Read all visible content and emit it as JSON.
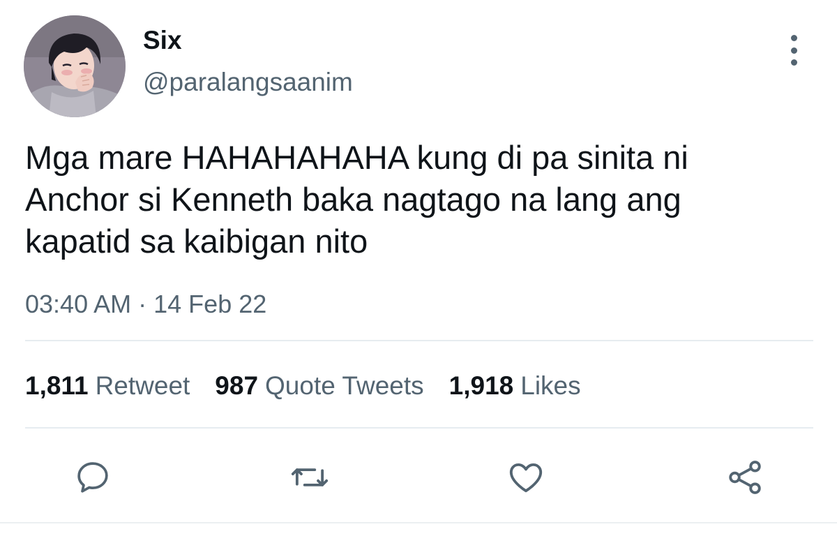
{
  "tweet": {
    "display_name": "Six",
    "handle": "@paralangsaanim",
    "text": "Mga mare HAHAHAHAHA kung di pa sinita ni\nAnchor si Kenneth baka nagtago na lang ang\nkapatid sa kaibigan nito",
    "time": "03:40 AM",
    "separator": "·",
    "date": "14 Feb 22"
  },
  "stats": {
    "retweets_count": "1,811",
    "retweets_label": "Retweet",
    "quotes_count": "987",
    "quotes_label": "Quote Tweets",
    "likes_count": "1,918",
    "likes_label": "Likes"
  },
  "icons": {
    "more": "more-vertical-icon",
    "reply": "reply-icon",
    "retweet": "retweet-icon",
    "like": "heart-icon",
    "share": "share-icon"
  },
  "colors": {
    "text_primary": "#0f1419",
    "text_secondary": "#536471",
    "divider": "#e6ecf0"
  }
}
